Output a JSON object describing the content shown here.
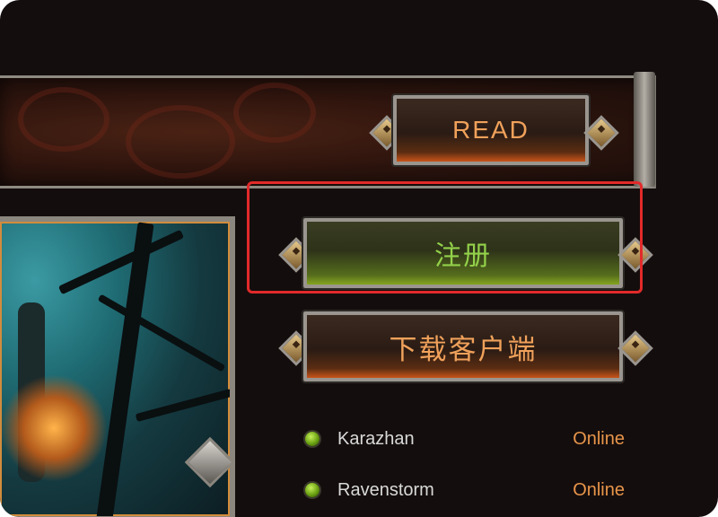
{
  "buttons": {
    "read": "READ",
    "register": "注册",
    "download": "下载客户端"
  },
  "realms": [
    {
      "name": "Karazhan",
      "status": "Online"
    },
    {
      "name": "Ravenstorm",
      "status": "Online"
    }
  ],
  "colors": {
    "background": "#140d0d",
    "orange_text": "#f0a15a",
    "green_text": "#93d14a",
    "highlight": "#e22a2a",
    "online": "#e8954a"
  }
}
